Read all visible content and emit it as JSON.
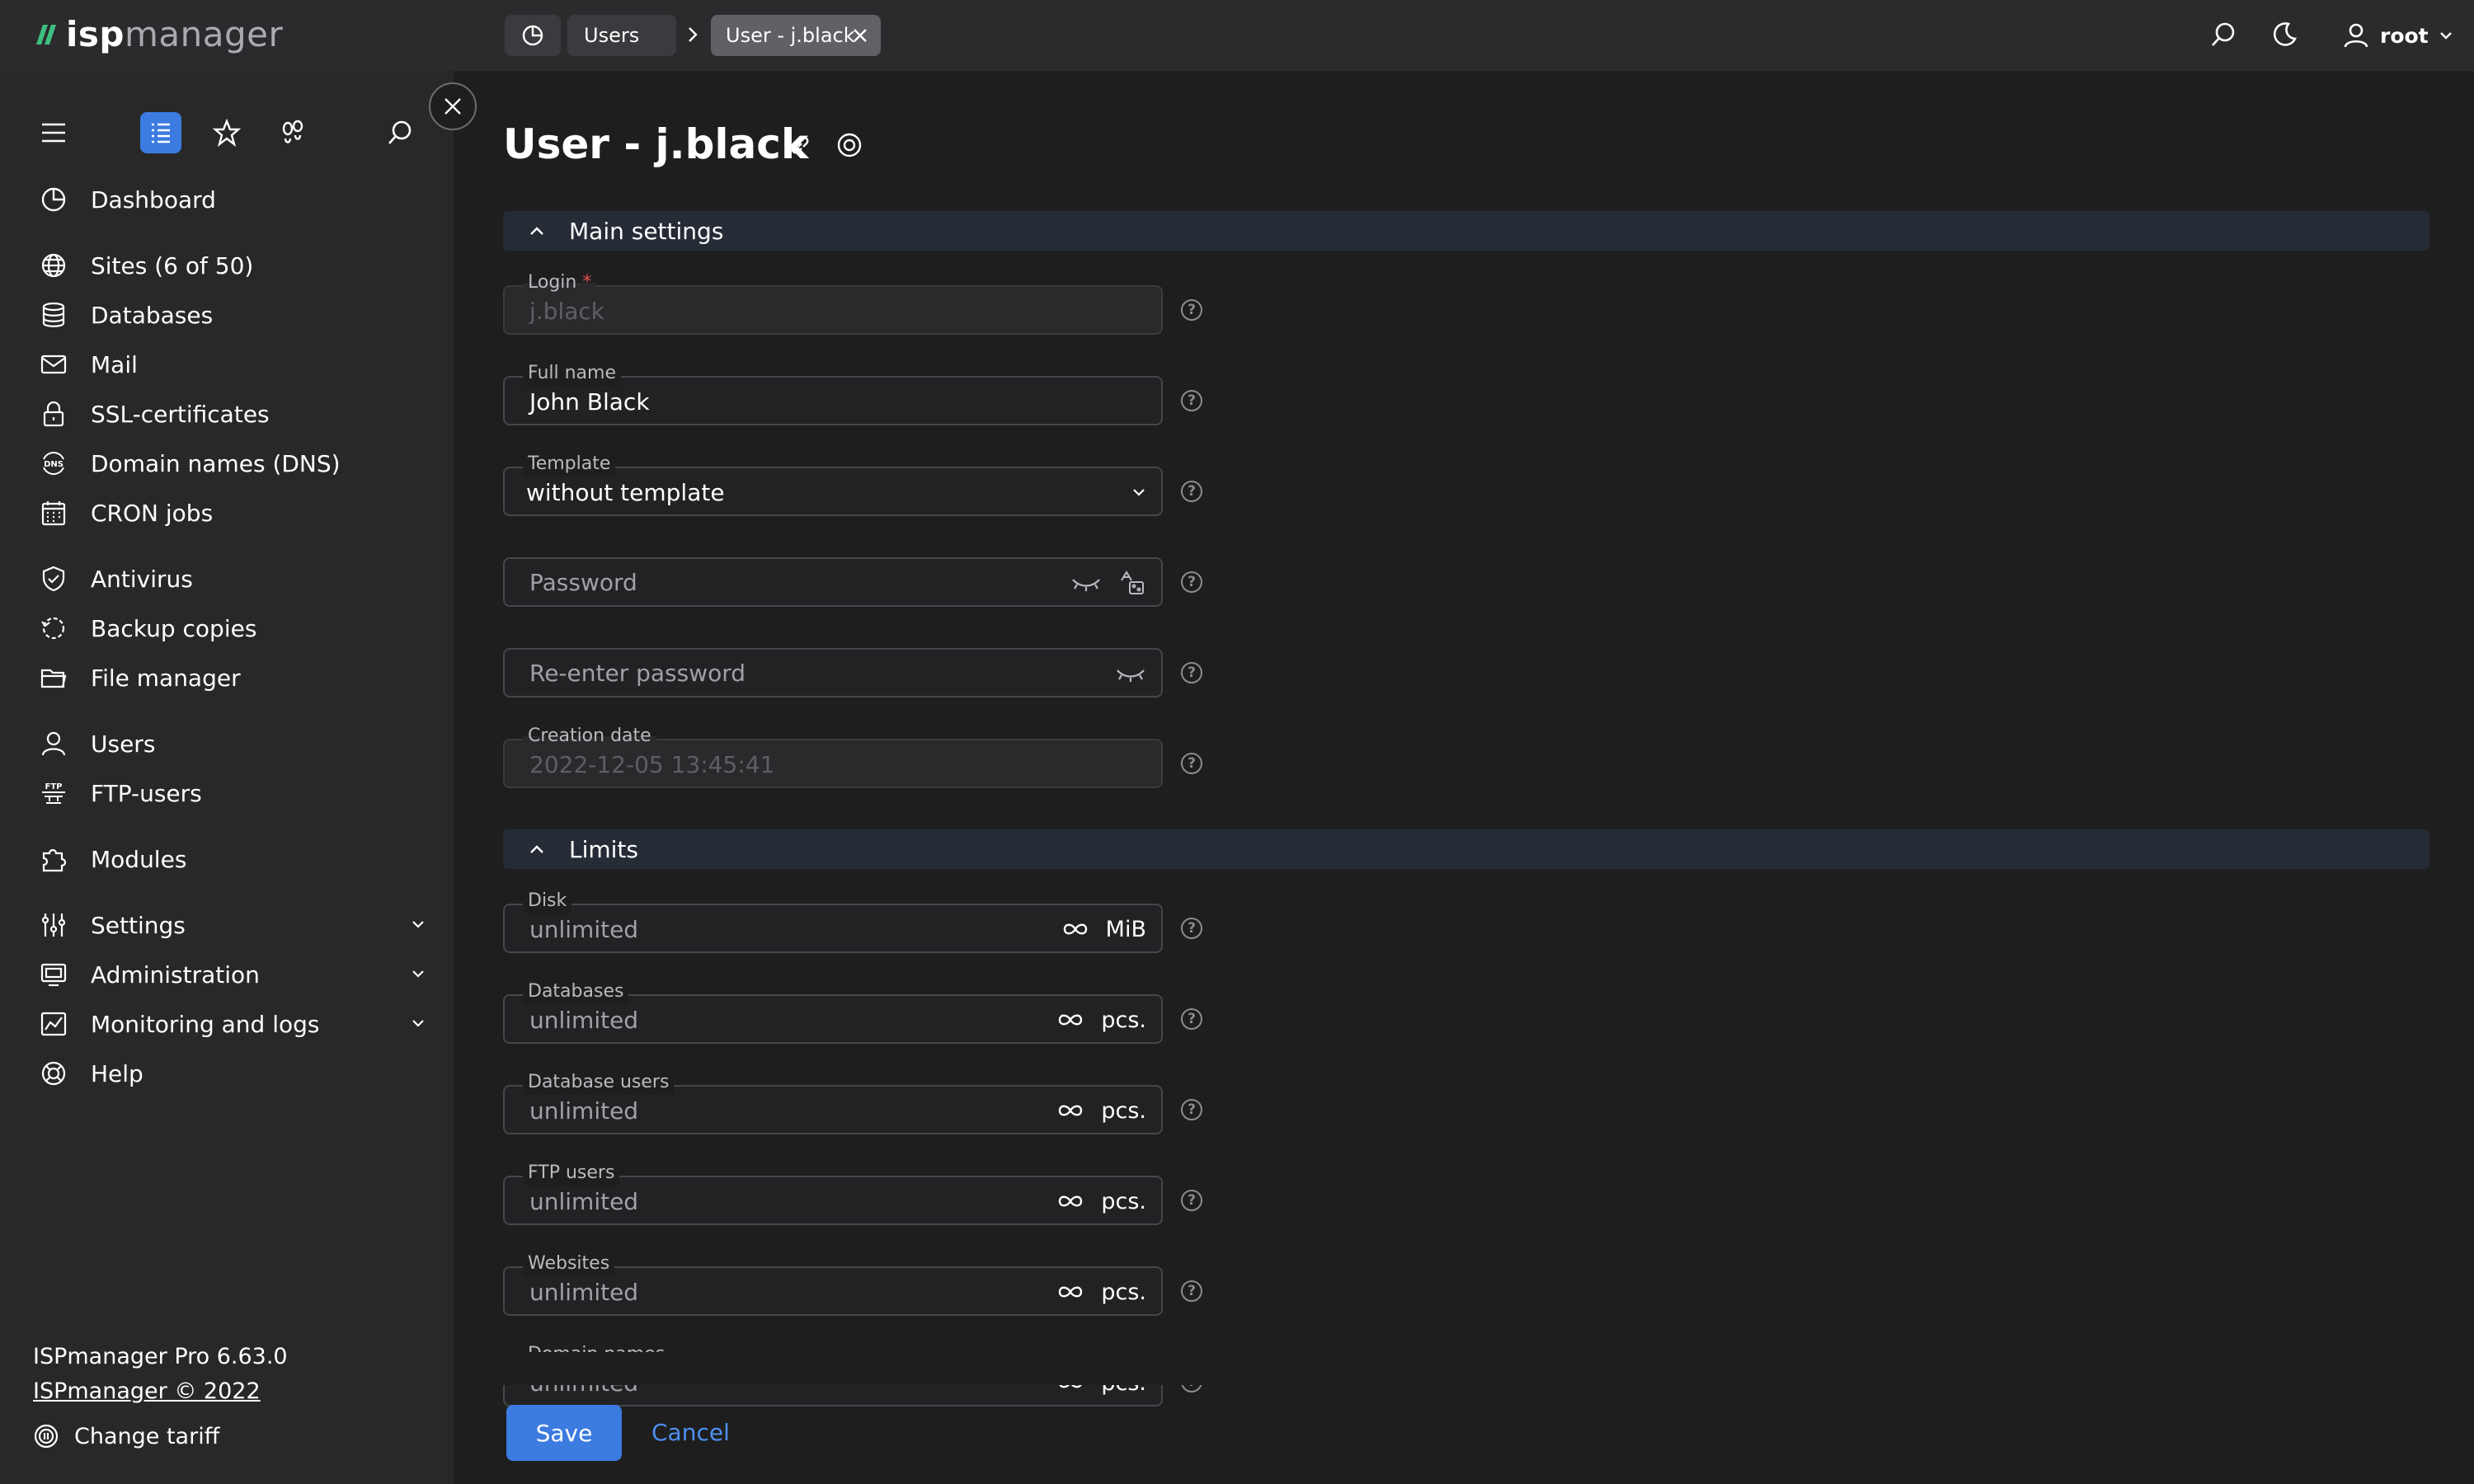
{
  "app": {
    "logo_isp": "isp",
    "logo_manager": "manager"
  },
  "breadcrumb": {
    "users_label": "Users",
    "active_label": "User - j.black"
  },
  "topbar": {
    "user_name": "root"
  },
  "sidebar": {
    "items": [
      {
        "label": "Dashboard",
        "icon": "dashboard-icon"
      },
      {
        "label": "Sites (6 of 50)",
        "icon": "globe-icon"
      },
      {
        "label": "Databases",
        "icon": "database-icon"
      },
      {
        "label": "Mail",
        "icon": "mail-icon"
      },
      {
        "label": "SSL-certificates",
        "icon": "lock-icon"
      },
      {
        "label": "Domain names (DNS)",
        "icon": "dns-icon"
      },
      {
        "label": "CRON jobs",
        "icon": "calendar-icon"
      },
      {
        "label": "Antivirus",
        "icon": "shield-icon"
      },
      {
        "label": "Backup copies",
        "icon": "backup-icon"
      },
      {
        "label": "File manager",
        "icon": "folder-icon"
      },
      {
        "label": "Users",
        "icon": "user-icon"
      },
      {
        "label": "FTP-users",
        "icon": "ftp-icon"
      },
      {
        "label": "Modules",
        "icon": "puzzle-icon"
      },
      {
        "label": "Settings",
        "icon": "sliders-icon"
      },
      {
        "label": "Administration",
        "icon": "monitor-icon"
      },
      {
        "label": "Monitoring and logs",
        "icon": "chart-icon"
      },
      {
        "label": "Help",
        "icon": "lifebuoy-icon"
      }
    ],
    "version": "ISPmanager Pro 6.63.0",
    "copyright": "ISPmanager © 2022",
    "change_tariff": "Change tariff"
  },
  "page": {
    "title": "User - j.black"
  },
  "sections": {
    "main": "Main settings",
    "limits": "Limits"
  },
  "form": {
    "login": {
      "label": "Login",
      "required_mark": "*",
      "value": "j.black"
    },
    "fullname": {
      "label": "Full name",
      "value": "John Black"
    },
    "template": {
      "label": "Template",
      "value": "without template"
    },
    "password": {
      "placeholder": "Password"
    },
    "repassword": {
      "placeholder": "Re-enter password"
    },
    "created": {
      "label": "Creation date",
      "value": "2022-12-05 13:45:41"
    }
  },
  "limits": [
    {
      "label": "Disk",
      "value": "unlimited",
      "unit": "MiB"
    },
    {
      "label": "Databases",
      "value": "unlimited",
      "unit": "pcs."
    },
    {
      "label": "Database users",
      "value": "unlimited",
      "unit": "pcs."
    },
    {
      "label": "FTP users",
      "value": "unlimited",
      "unit": "pcs."
    },
    {
      "label": "Websites",
      "value": "unlimited",
      "unit": "pcs."
    },
    {
      "label": "Domain names",
      "value": "unlimited",
      "unit": "pcs."
    }
  ],
  "help_mark": "?",
  "actions": {
    "save": "Save",
    "cancel": "Cancel"
  },
  "colors": {
    "accent": "#3c7be0",
    "link": "#4d8ff0",
    "required": "#e3504f"
  }
}
